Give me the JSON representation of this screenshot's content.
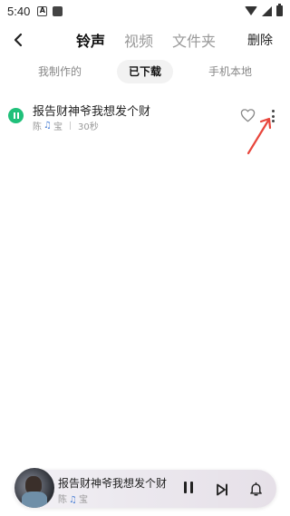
{
  "status_bar": {
    "time": "5:40",
    "icons": [
      "notification-a-icon",
      "notification-square-icon",
      "wifi-icon",
      "signal-icon",
      "battery-icon"
    ]
  },
  "header": {
    "tabs": [
      {
        "label": "铃声",
        "active": true
      },
      {
        "label": "视频",
        "active": false
      },
      {
        "label": "文件夹",
        "active": false
      }
    ],
    "delete_label": "删除"
  },
  "subtabs": [
    {
      "label": "我制作的",
      "active": false
    },
    {
      "label": "已下载",
      "active": true
    },
    {
      "label": "手机本地",
      "active": false
    }
  ],
  "ringtones": [
    {
      "title": "报告财神爷我想发个财",
      "artist_prefix": "陈",
      "artist_suffix": "宝",
      "duration": "30秒",
      "playing": true
    }
  ],
  "player": {
    "title": "报告财神爷我想发个财",
    "artist_prefix": "陈",
    "artist_suffix": "宝",
    "state": "playing"
  },
  "colors": {
    "accent_green": "#20c07a",
    "annotation_red": "#e8463c",
    "note_blue": "#4a7fd4"
  }
}
